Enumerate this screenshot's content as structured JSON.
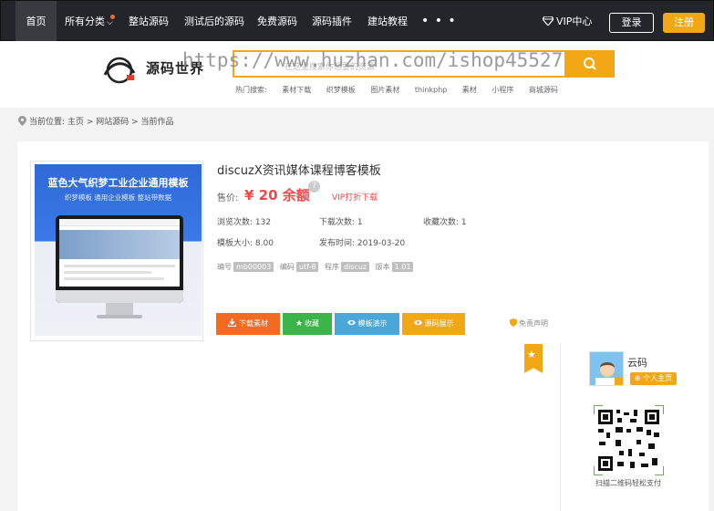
{
  "nav": {
    "items": [
      {
        "label": "首页",
        "active": true
      },
      {
        "label": "所有分类",
        "has_dropdown": true,
        "hot": true
      },
      {
        "label": "整站源码"
      },
      {
        "label": "测试后的源码"
      },
      {
        "label": "免费源码"
      },
      {
        "label": "源码插件"
      },
      {
        "label": "建站教程"
      }
    ],
    "more": "• • •",
    "vip_label": "VIP中心",
    "login_label": "登录",
    "register_label": "注册"
  },
  "header": {
    "logo_text": "源码世界",
    "search_placeholder": "在这里搜索你想要的资源",
    "watermark": "https://www.huzhan.com/ishop45527",
    "hot_label": "热门搜索:",
    "hot_words": [
      "素材下载",
      "织梦模板",
      "图片素材",
      "thinkphp",
      "素材",
      "小程序",
      "商城源码"
    ]
  },
  "breadcrumb": {
    "prefix": "当前位置:",
    "items": [
      "主页",
      "网站源码",
      "当前作品"
    ],
    "separator": ">"
  },
  "product": {
    "thumb_title": "蓝色大气织梦工业企业通用模板",
    "thumb_subtitle": "织梦模板 通用企业模板 整站带数据",
    "title": "discuzX资讯媒体课程博客模板",
    "price_label": "售价:",
    "price_value": "¥ 20 余额",
    "vip_download": "VIP打折下载",
    "meta": {
      "views_label": "浏览次数:",
      "views": "132",
      "downloads_label": "下载次数:",
      "downloads": "1",
      "favorites_label": "收藏次数:",
      "favorites": "1",
      "size_label": "模板大小:",
      "size": "8.00",
      "published_label": "发布时间:",
      "published": "2019-03-20"
    },
    "tags": [
      {
        "label": "编号",
        "value": "mb00003"
      },
      {
        "label": "编码",
        "value": "utf-8"
      },
      {
        "label": "程序",
        "value": "discuz"
      },
      {
        "label": "版本",
        "value": "1.01"
      }
    ],
    "buttons": {
      "download": "下载素材",
      "favorite": "收藏",
      "demo": "模板演示",
      "source": "源码展示"
    },
    "disclaimer": "免责声明"
  },
  "author": {
    "name": "云码",
    "homepage_label": "个人主页",
    "qr_caption": "扫描二维码轻松支付"
  },
  "colors": {
    "topbar": "#24252a",
    "accent": "#f2a814",
    "price": "#f04848",
    "download": "#f26b21",
    "favorite": "#3bb44a",
    "demo": "#4aa7d9"
  }
}
